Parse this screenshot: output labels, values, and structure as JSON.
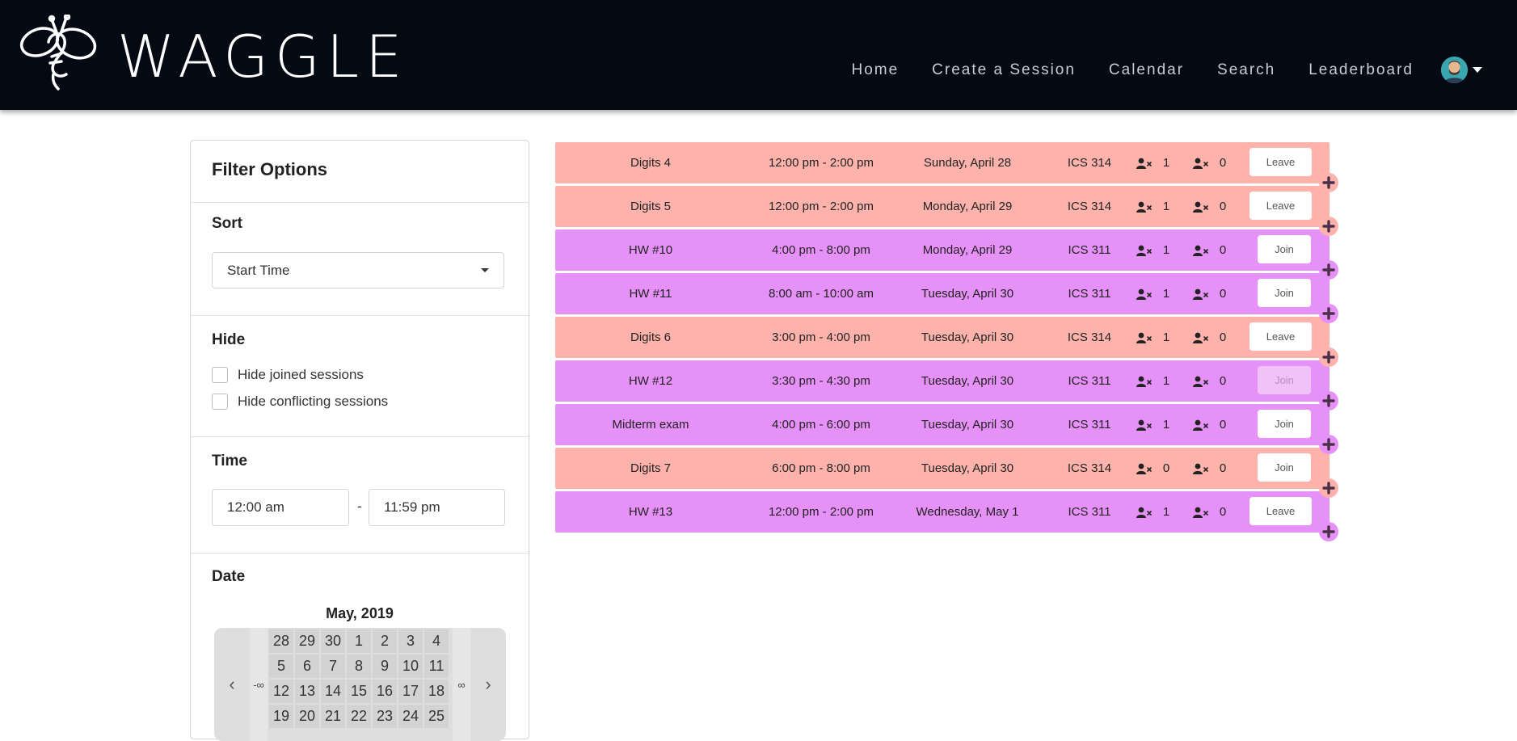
{
  "brand": {
    "name": "WAGGLE"
  },
  "nav": {
    "items": [
      {
        "label": "Home"
      },
      {
        "label": "Create a Session"
      },
      {
        "label": "Calendar"
      },
      {
        "label": "Search"
      },
      {
        "label": "Leaderboard"
      }
    ]
  },
  "filter": {
    "title": "Filter Options",
    "sort": {
      "heading": "Sort",
      "selected": "Start Time"
    },
    "hide": {
      "heading": "Hide",
      "options": [
        {
          "label": "Hide joined sessions",
          "checked": false
        },
        {
          "label": "Hide conflicting sessions",
          "checked": false
        }
      ]
    },
    "time": {
      "heading": "Time",
      "start": "12:00 am",
      "separator": "-",
      "end": "11:59 pm"
    },
    "date": {
      "heading": "Date",
      "month_label": "May, 2019",
      "left_range": "-∞",
      "right_range": "∞",
      "weeks": [
        [
          "28",
          "29",
          "30",
          "1",
          "2",
          "3",
          "4"
        ],
        [
          "",
          "5",
          "6",
          "7",
          "8",
          "9",
          "10",
          "11"
        ],
        [
          "12",
          "13",
          "14",
          "15",
          "16",
          "17",
          "18"
        ],
        [
          "19",
          "20",
          "21",
          "22",
          "23",
          "24",
          "25"
        ]
      ]
    }
  },
  "colors": {
    "navbar": "#030a14",
    "ics314": "#fdb3ac",
    "ics311": "#e691f7"
  },
  "sessions": [
    {
      "name": "Digits 4",
      "time": "12:00 pm - 2:00 pm",
      "date": "Sunday, April 28",
      "course": "ICS 314",
      "count1": "1",
      "count2": "0",
      "action": "Leave"
    },
    {
      "name": "Digits 5",
      "time": "12:00 pm - 2:00 pm",
      "date": "Monday, April 29",
      "course": "ICS 314",
      "count1": "1",
      "count2": "0",
      "action": "Leave"
    },
    {
      "name": "HW #10",
      "time": "4:00 pm - 8:00 pm",
      "date": "Monday, April 29",
      "course": "ICS 311",
      "count1": "1",
      "count2": "0",
      "action": "Join"
    },
    {
      "name": "HW #11",
      "time": "8:00 am - 10:00 am",
      "date": "Tuesday, April 30",
      "course": "ICS 311",
      "count1": "1",
      "count2": "0",
      "action": "Join"
    },
    {
      "name": "Digits 6",
      "time": "3:00 pm - 4:00 pm",
      "date": "Tuesday, April 30",
      "course": "ICS 314",
      "count1": "1",
      "count2": "0",
      "action": "Leave"
    },
    {
      "name": "HW #12",
      "time": "3:30 pm - 4:30 pm",
      "date": "Tuesday, April 30",
      "course": "ICS 311",
      "count1": "1",
      "count2": "0",
      "action": "Join",
      "disabled": true
    },
    {
      "name": "Midterm exam",
      "time": "4:00 pm - 6:00 pm",
      "date": "Tuesday, April 30",
      "course": "ICS 311",
      "count1": "1",
      "count2": "0",
      "action": "Join"
    },
    {
      "name": "Digits 7",
      "time": "6:00 pm - 8:00 pm",
      "date": "Tuesday, April 30",
      "course": "ICS 314",
      "count1": "0",
      "count2": "0",
      "action": "Join"
    },
    {
      "name": "HW #13",
      "time": "12:00 pm - 2:00 pm",
      "date": "Wednesday, May 1",
      "course": "ICS 311",
      "count1": "1",
      "count2": "0",
      "action": "Leave"
    }
  ]
}
